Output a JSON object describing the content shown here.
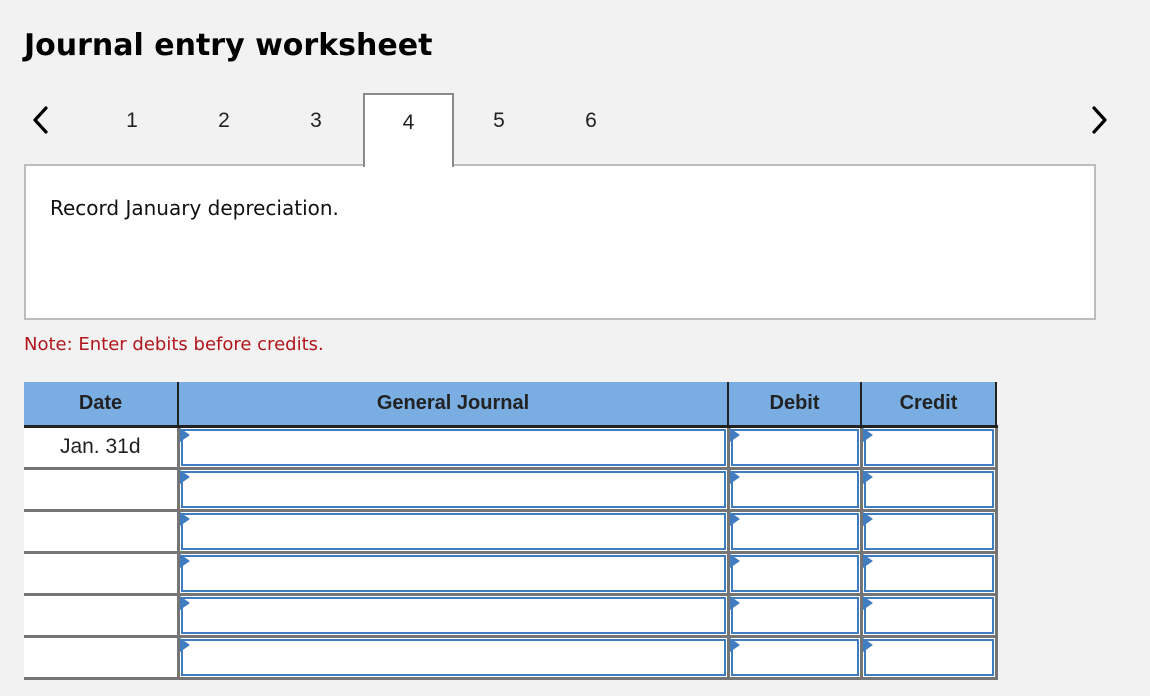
{
  "title": "Journal entry worksheet",
  "nav": {
    "prev_icon": "chevron-left-icon",
    "next_icon": "chevron-right-icon"
  },
  "tabs": [
    {
      "label": "1",
      "active": false
    },
    {
      "label": "2",
      "active": false
    },
    {
      "label": "3",
      "active": false
    },
    {
      "label": "4",
      "active": true
    },
    {
      "label": "5",
      "active": false
    },
    {
      "label": "6",
      "active": false
    }
  ],
  "prompt": "Record January depreciation.",
  "note": "Note: Enter debits before credits.",
  "colors": {
    "header_bg": "#7aade2",
    "input_border": "#3f7cc0",
    "note": "#b0161c"
  },
  "table": {
    "headers": {
      "date": "Date",
      "general_journal": "General Journal",
      "debit": "Debit",
      "credit": "Credit"
    },
    "rows": [
      {
        "date": "Jan. 31d",
        "account": "",
        "debit": "",
        "credit": ""
      },
      {
        "date": "",
        "account": "",
        "debit": "",
        "credit": ""
      },
      {
        "date": "",
        "account": "",
        "debit": "",
        "credit": ""
      },
      {
        "date": "",
        "account": "",
        "debit": "",
        "credit": ""
      },
      {
        "date": "",
        "account": "",
        "debit": "",
        "credit": ""
      },
      {
        "date": "",
        "account": "",
        "debit": "",
        "credit": ""
      }
    ]
  }
}
